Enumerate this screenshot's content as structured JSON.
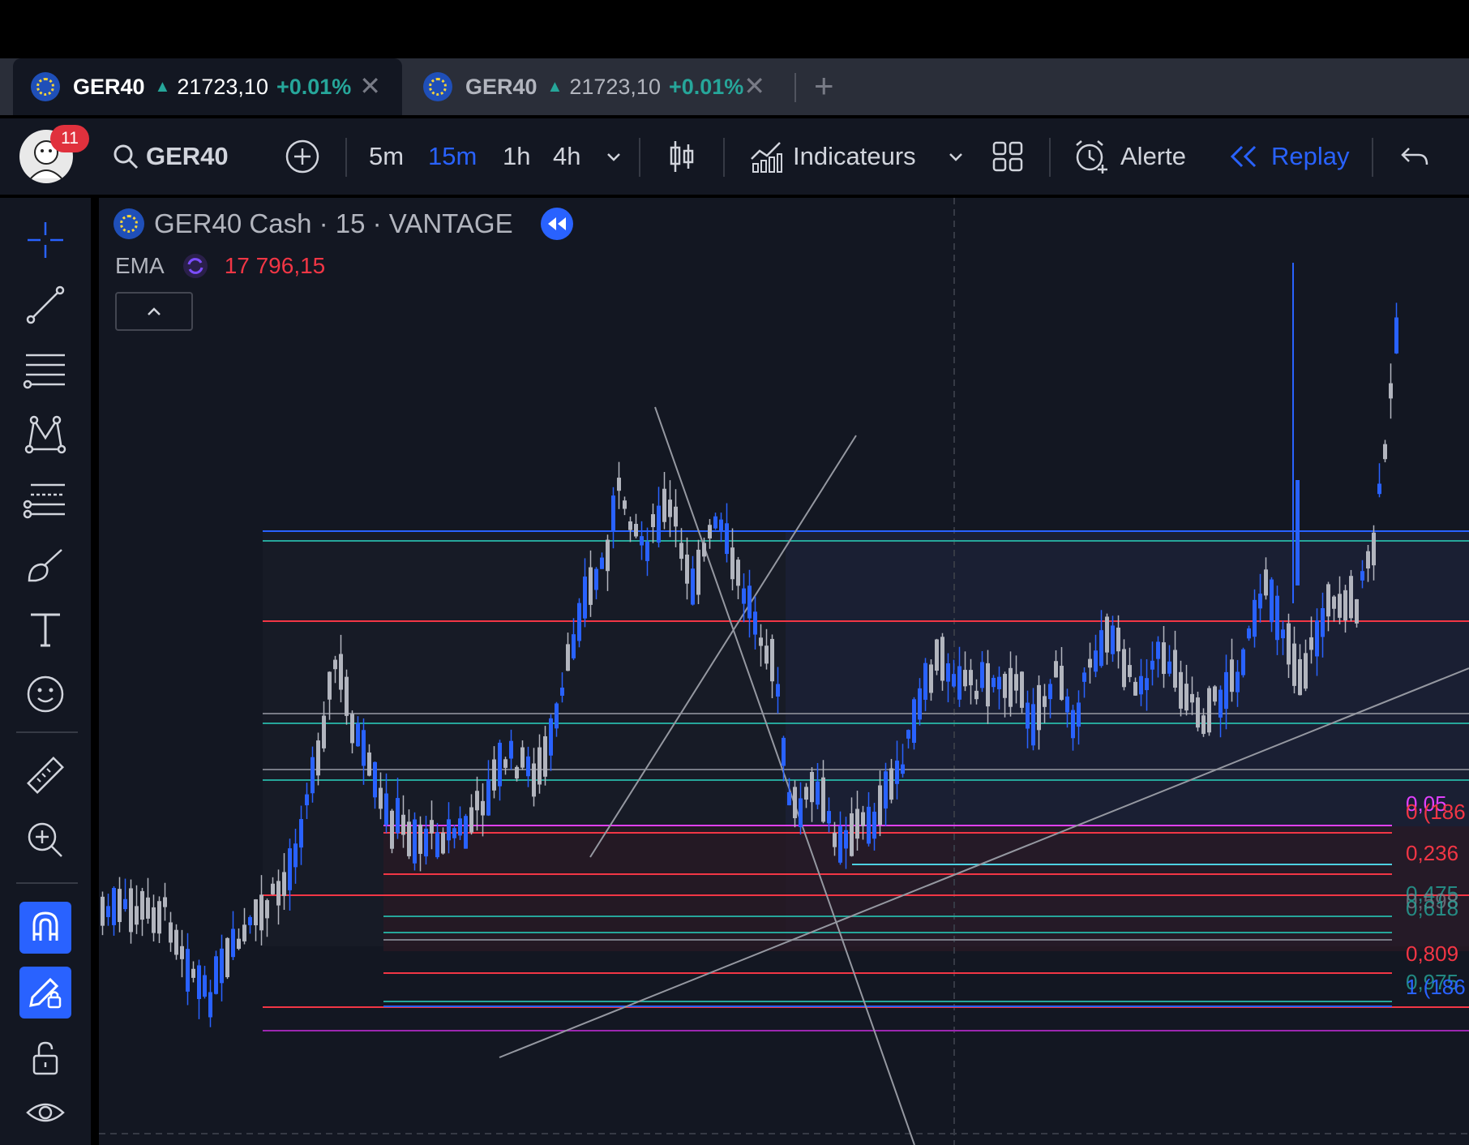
{
  "tabs": [
    {
      "symbol": "GER40",
      "price": "21723,10",
      "change": "+0.01%",
      "close": "✕"
    },
    {
      "symbol": "GER40",
      "price": "21723,10",
      "change": "+0.01%",
      "close": "✕"
    }
  ],
  "tab_add": "+",
  "toolbar": {
    "notification_count": "11",
    "symbol": "GER40",
    "intervals": [
      "5m",
      "15m",
      "1h",
      "4h"
    ],
    "selected_interval": "15m",
    "indicators_label": "Indicateurs",
    "alert_label": "Alerte",
    "replay_label": "Replay"
  },
  "chart": {
    "title": "GER40 Cash · 15 · VANTAGE",
    "ema_label": "EMA",
    "ema_value": "17 796,15",
    "fib_labels": [
      "0,05",
      "0 (186",
      "0,236",
      "0,475",
      "0,598",
      "0,618",
      "0,809",
      "0,975",
      "1 (186"
    ]
  },
  "colors": {
    "accent": "#2962ff",
    "up": "#26a69a",
    "down": "#f23645",
    "candle_up": "#2962ff",
    "candle_down": "#b2b5be"
  }
}
